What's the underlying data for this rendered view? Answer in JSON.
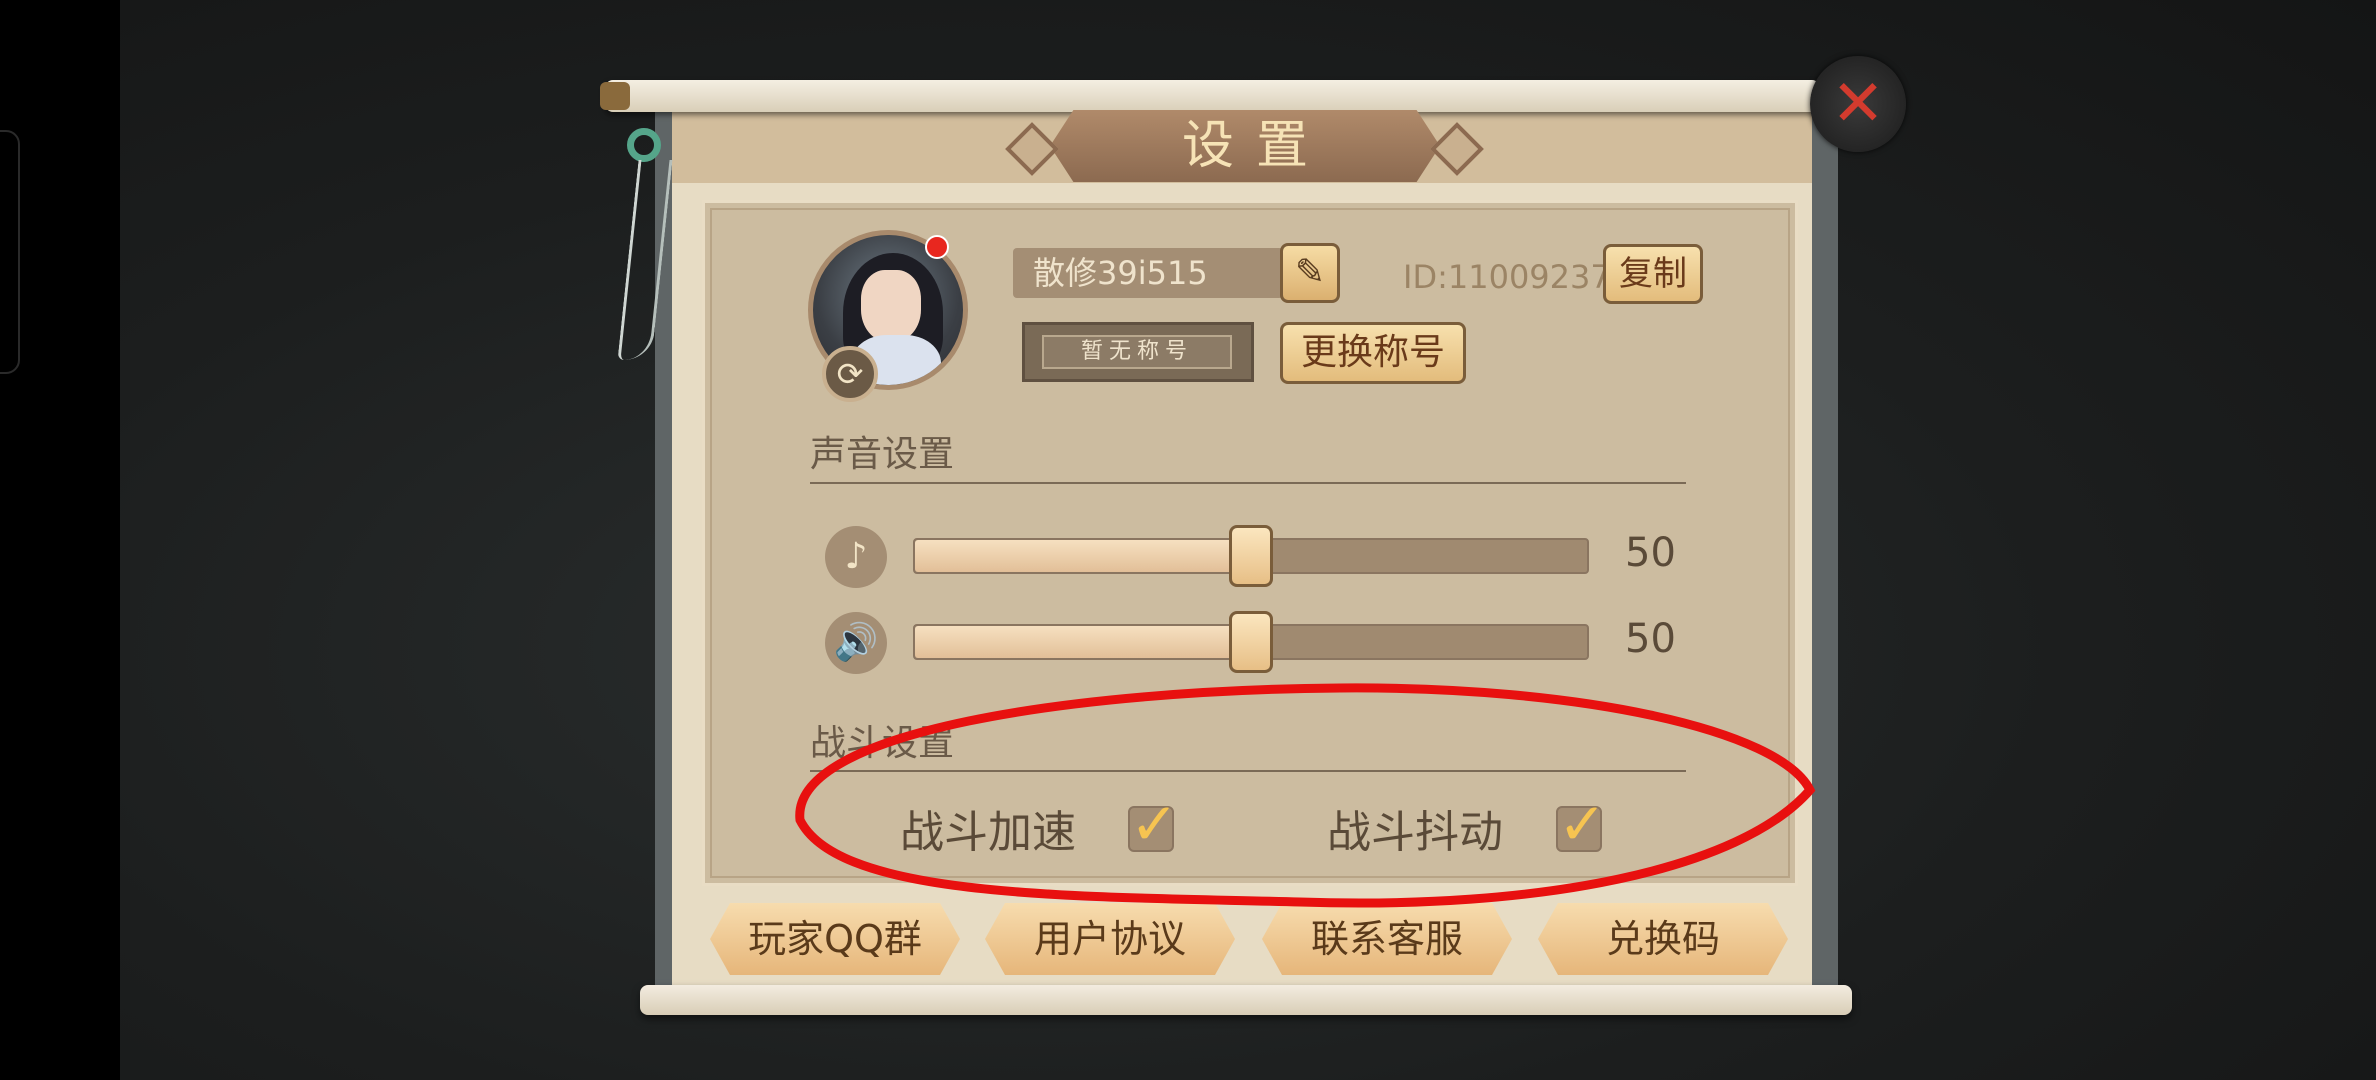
{
  "dialog": {
    "title": "设置",
    "close_icon": "close-icon"
  },
  "profile": {
    "name": "散修39i515",
    "id_text": "ID:11009237",
    "copy_label": "复制",
    "title_badge": "暂无称号",
    "change_title_label": "更换称号"
  },
  "sound": {
    "section_label": "声音设置",
    "music": {
      "icon": "music-note-icon",
      "value": 50,
      "display": "50"
    },
    "effects": {
      "icon": "speaker-icon",
      "value": 50,
      "display": "50"
    }
  },
  "battle": {
    "section_label": "战斗设置",
    "speed_up": {
      "label": "战斗加速",
      "checked": true
    },
    "shake": {
      "label": "战斗抖动",
      "checked": true
    }
  },
  "footer": {
    "buttons": [
      "玩家QQ群",
      "用户协议",
      "联系客服",
      "兑换码"
    ]
  },
  "annotation": {
    "color": "#e8100f"
  }
}
